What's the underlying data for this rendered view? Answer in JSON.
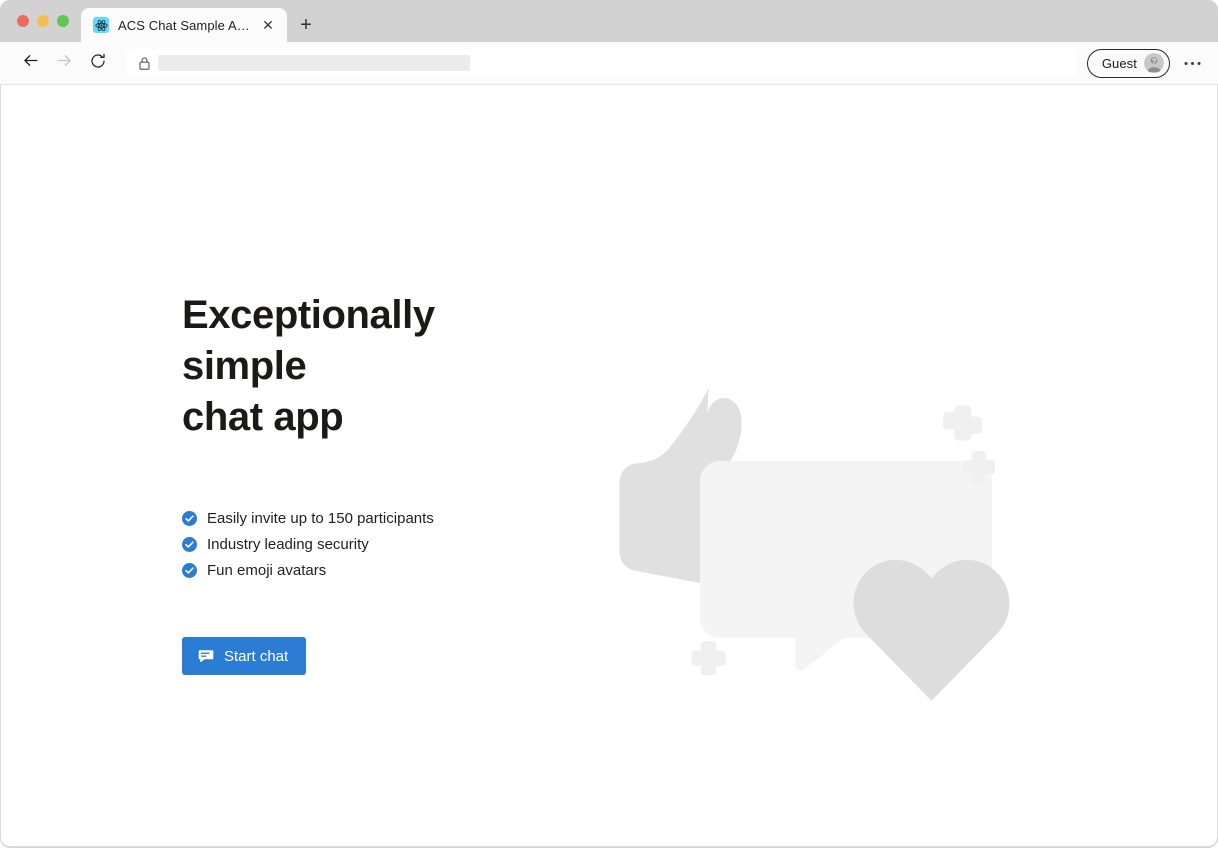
{
  "browser": {
    "traffic_lights": [
      "close",
      "minimize",
      "maximize"
    ],
    "tab": {
      "title": "ACS Chat Sample App",
      "favicon": "react-logo-icon",
      "close_label": "✕"
    },
    "new_tab_label": "+",
    "toolbar": {
      "back_icon": "back-arrow-icon",
      "forward_icon": "forward-arrow-icon",
      "reload_icon": "reload-icon",
      "lock_icon": "lock-icon",
      "url_value": "",
      "url_placeholder": "",
      "profile_label": "Guest",
      "profile_avatar_icon": "guest-avatar-icon",
      "more_label": "•••"
    }
  },
  "page": {
    "title_line1": "Exceptionally simple",
    "title_line2": "chat app",
    "features": [
      {
        "icon": "check-circle-icon",
        "text": "Easily invite up to 150 participants"
      },
      {
        "icon": "check-circle-icon",
        "text": "Industry leading security"
      },
      {
        "icon": "check-circle-icon",
        "text": "Fun emoji avatars"
      }
    ],
    "cta": {
      "label": "Start chat",
      "icon": "chat-bubble-icon"
    },
    "illustration": {
      "name": "chat-hero-illustration",
      "shapes": [
        "thumbs-up",
        "speech-bubble",
        "heart",
        "plus-sparkle",
        "plus-sparkle",
        "plus-sparkle"
      ]
    }
  },
  "colors": {
    "accent": "#2b7cd3",
    "check": "#2b7cd3",
    "title_bar": "#d2d2d2",
    "toolbar": "#fbfbfb",
    "page_bg": "#ffffff",
    "art_light": "#f4f4f4",
    "art_mid": "#e3e3e3",
    "art_dark": "#d8d8d8"
  }
}
